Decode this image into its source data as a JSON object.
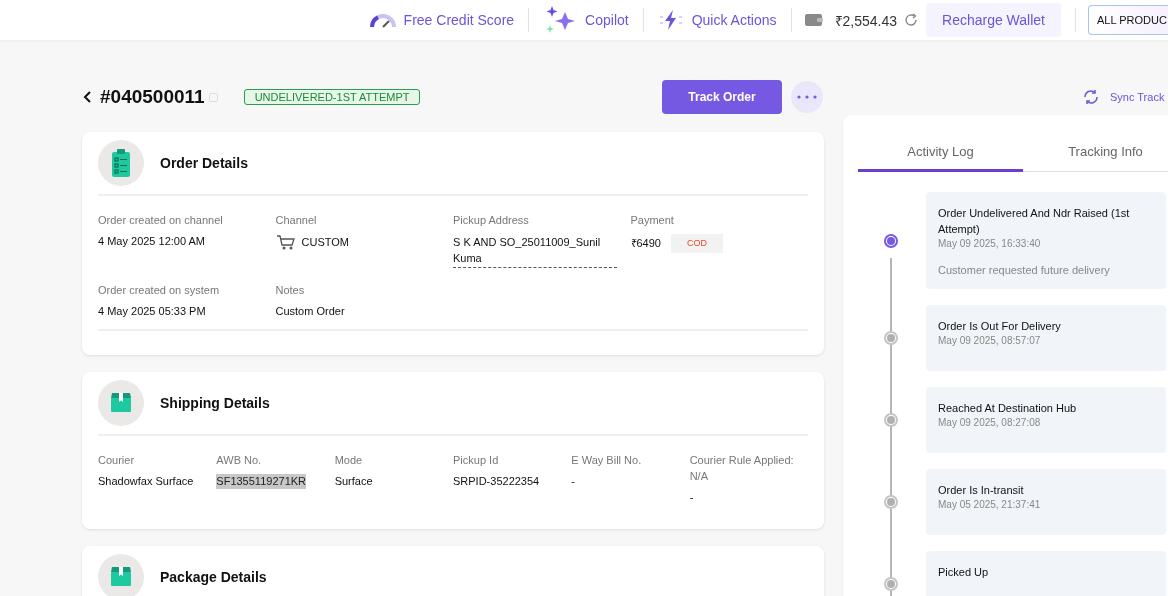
{
  "top_bar": {
    "items": [
      {
        "kind": "gauge",
        "label": "Free Credit Score"
      },
      {
        "kind": "sparkle",
        "label": "Copilot"
      },
      {
        "kind": "bolt",
        "label": "Quick Actions"
      }
    ],
    "wallet": {
      "balance": "₹2,554.43",
      "button": "Recharge Wallet"
    },
    "products_button": "ALL PRODUC"
  },
  "order": {
    "id": "#040500011",
    "status": "UNDELIVERED-1ST ATTEMPT",
    "track_button": "Track Order"
  },
  "sections": [
    {
      "kind": "order",
      "title": "Order Details",
      "fields": [
        {
          "kind": "text",
          "label": "Order created on channel",
          "value": "4 May 2025 12:00 AM"
        },
        {
          "kind": "channel",
          "label": "Channel",
          "value": "CUSTOM"
        },
        {
          "kind": "address",
          "label": "Pickup Address",
          "value": "S K AND SO_25011009_Sunil Kuma"
        },
        {
          "kind": "payment",
          "label": "Payment",
          "value": "₹6490",
          "tag": "COD"
        },
        {
          "kind": "text",
          "label": "Order created on system",
          "value": "4 May 2025 05:33 PM"
        },
        {
          "kind": "text",
          "label": "Notes",
          "value": "Custom Order"
        }
      ]
    },
    {
      "kind": "box",
      "title": "Shipping Details",
      "fields": [
        {
          "kind": "text",
          "label": "Courier",
          "value": "Shadowfax Surface"
        },
        {
          "kind": "highlight",
          "label": "AWB No.",
          "value": "SF1355119271KR"
        },
        {
          "kind": "text",
          "label": "Mode",
          "value": "Surface"
        },
        {
          "kind": "text",
          "label": "Pickup Id",
          "value": "SRPID-35222354"
        },
        {
          "kind": "text",
          "label": "E Way Bill No.",
          "value": "-"
        },
        {
          "kind": "text",
          "label": "Courier Rule Applied: N/A",
          "value": "-"
        }
      ]
    },
    {
      "kind": "box",
      "title": "Package Details"
    }
  ],
  "activity": {
    "sync_label": "Sync Track",
    "tabs": [
      {
        "label": "Activity Log",
        "selected": true
      },
      {
        "label": "Tracking Info",
        "selected": false
      }
    ],
    "events": [
      {
        "title": "Order Undelivered And Ndr Raised (1st Attempt)",
        "time": "May 09 2025, 16:33:40",
        "note": "Customer requested future delivery",
        "active": true
      },
      {
        "title": "Order Is Out For Delivery",
        "time": "May 09 2025, 08:57:07",
        "active": false
      },
      {
        "title": "Reached At Destination Hub",
        "time": "May 09 2025, 08:27:08",
        "active": false
      },
      {
        "title": "Order Is In-transit",
        "time": "May 05 2025, 21:37:41",
        "active": false
      },
      {
        "title": "Picked Up",
        "active": false
      }
    ]
  }
}
